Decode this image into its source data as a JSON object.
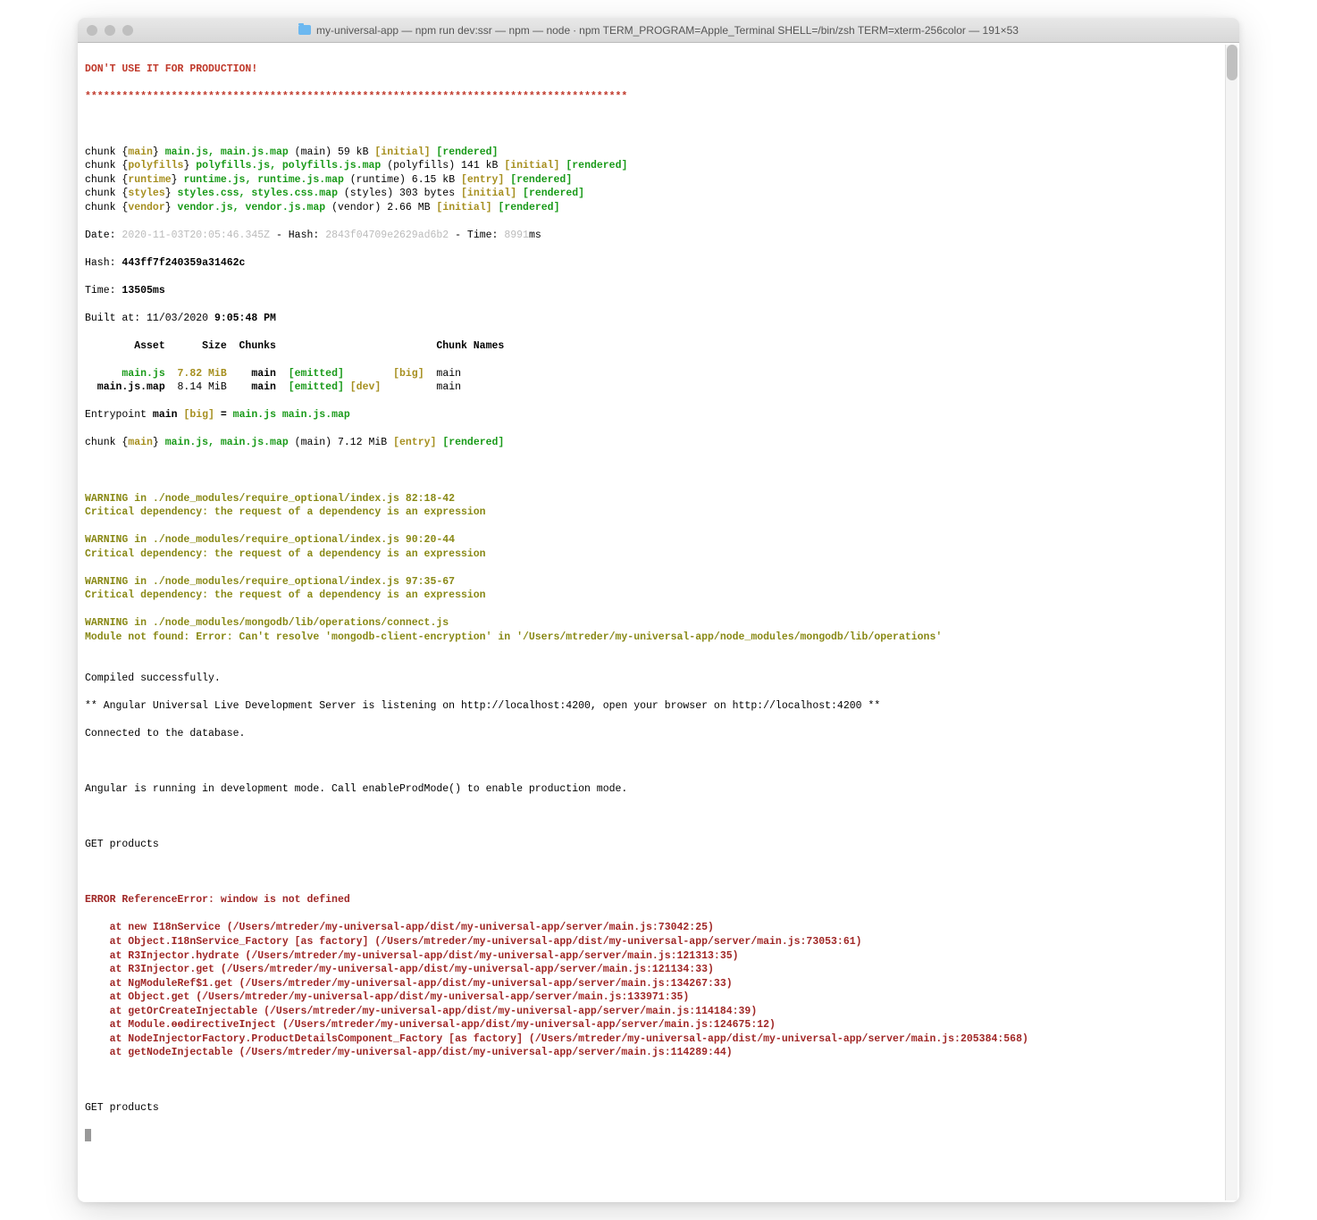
{
  "window": {
    "title": "my-universal-app — npm run dev:ssr — npm — node ∙ npm TERM_PROGRAM=Apple_Terminal SHELL=/bin/zsh TERM=xterm-256color — 191×53"
  },
  "warning_header": "DON'T USE IT FOR PRODUCTION!",
  "stars": "****************************************************************************************",
  "chunks": [
    {
      "prefix": "chunk {",
      "name": "main",
      "close": "} ",
      "files": "main.js, main.js.map",
      "info": " (main) 59 kB ",
      "tag1": "[initial]",
      "sp": " ",
      "tag2": "[rendered]"
    },
    {
      "prefix": "chunk {",
      "name": "polyfills",
      "close": "} ",
      "files": "polyfills.js, polyfills.js.map",
      "info": " (polyfills) 141 kB ",
      "tag1": "[initial]",
      "sp": " ",
      "tag2": "[rendered]"
    },
    {
      "prefix": "chunk {",
      "name": "runtime",
      "close": "} ",
      "files": "runtime.js, runtime.js.map",
      "info": " (runtime) 6.15 kB ",
      "tag1": "[entry]",
      "sp": " ",
      "tag2": "[rendered]"
    },
    {
      "prefix": "chunk {",
      "name": "styles",
      "close": "} ",
      "files": "styles.css, styles.css.map",
      "info": " (styles) 303 bytes ",
      "tag1": "[initial]",
      "sp": " ",
      "tag2": "[rendered]"
    },
    {
      "prefix": "chunk {",
      "name": "vendor",
      "close": "} ",
      "files": "vendor.js, vendor.js.map",
      "info": " (vendor) 2.66 MB ",
      "tag1": "[initial]",
      "sp": " ",
      "tag2": "[rendered]"
    }
  ],
  "date_line": {
    "prefix": "Date: ",
    "date": "2020-11-03T20:05:46.345Z",
    "mid": " - Hash: ",
    "hash": "2843f04709e2629ad6b2",
    "mid2": " - Time: ",
    "time": "8991",
    "suffix": "ms"
  },
  "hash_line": {
    "prefix": "Hash: ",
    "val": "443ff7f240359a31462c"
  },
  "time_line": {
    "prefix": "Time: ",
    "val": "13505ms"
  },
  "built_at": {
    "prefix": "Built at: 11/03/2020 ",
    "val": "9:05:48 PM"
  },
  "assets": {
    "header": "        Asset      Size  Chunks                          Chunk Names",
    "rows": [
      {
        "name": "      main.js",
        "size": "  7.82 MiB",
        "chunk": "    main",
        "emit": "  [emitted]",
        "dev": "        ",
        "big": "[big]",
        "names": "  main"
      },
      {
        "name": "  main.js.map",
        "size": "  8.14 MiB",
        "chunk": "    main",
        "emit": "  [emitted]",
        "dev": " [dev]  ",
        "big": "     ",
        "names": "  main"
      }
    ]
  },
  "entrypoint": {
    "prefix": "Entrypoint ",
    "name": "main ",
    "big": "[big]",
    "eq": " = ",
    "files": "main.js main.js.map"
  },
  "chunk2": {
    "prefix": "chunk {",
    "name": "main",
    "close": "} ",
    "files": "main.js, main.js.map",
    "info": " (main) 7.12 MiB ",
    "tag1": "[entry]",
    "sp": " ",
    "tag2": "[rendered]"
  },
  "warnings": [
    {
      "l1": "WARNING in ./node_modules/require_optional/index.js 82:18-42",
      "l2": "Critical dependency: the request of a dependency is an expression"
    },
    {
      "l1": "WARNING in ./node_modules/require_optional/index.js 90:20-44",
      "l2": "Critical dependency: the request of a dependency is an expression"
    },
    {
      "l1": "WARNING in ./node_modules/require_optional/index.js 97:35-67",
      "l2": "Critical dependency: the request of a dependency is an expression"
    },
    {
      "l1": "WARNING in ./node_modules/mongodb/lib/operations/connect.js",
      "l2": "Module not found: Error: Can't resolve 'mongodb-client-encryption' in '/Users/mtreder/my-universal-app/node_modules/mongodb/lib/operations'"
    }
  ],
  "compile": {
    "ok": "Compiled successfully.",
    "server": "** Angular Universal Live Development Server is listening on http://localhost:4200, open your browser on http://localhost:4200 **",
    "db": "Connected to the database.",
    "devmode": "Angular is running in development mode. Call enableProdMode() to enable production mode.",
    "get1": "GET products",
    "get2": "GET products"
  },
  "error": {
    "head": "ERROR ReferenceError: window is not defined",
    "trace": [
      "    at new I18nService (/Users/mtreder/my-universal-app/dist/my-universal-app/server/main.js:73042:25)",
      "    at Object.I18nService_Factory [as factory] (/Users/mtreder/my-universal-app/dist/my-universal-app/server/main.js:73053:61)",
      "    at R3Injector.hydrate (/Users/mtreder/my-universal-app/dist/my-universal-app/server/main.js:121313:35)",
      "    at R3Injector.get (/Users/mtreder/my-universal-app/dist/my-universal-app/server/main.js:121134:33)",
      "    at NgModuleRef$1.get (/Users/mtreder/my-universal-app/dist/my-universal-app/server/main.js:134267:33)",
      "    at Object.get (/Users/mtreder/my-universal-app/dist/my-universal-app/server/main.js:133971:35)",
      "    at getOrCreateInjectable (/Users/mtreder/my-universal-app/dist/my-universal-app/server/main.js:114184:39)",
      "    at Module.ɵɵdirectiveInject (/Users/mtreder/my-universal-app/dist/my-universal-app/server/main.js:124675:12)",
      "    at NodeInjectorFactory.ProductDetailsComponent_Factory [as factory] (/Users/mtreder/my-universal-app/dist/my-universal-app/server/main.js:205384:568)",
      "    at getNodeInjectable (/Users/mtreder/my-universal-app/dist/my-universal-app/server/main.js:114289:44)"
    ]
  }
}
